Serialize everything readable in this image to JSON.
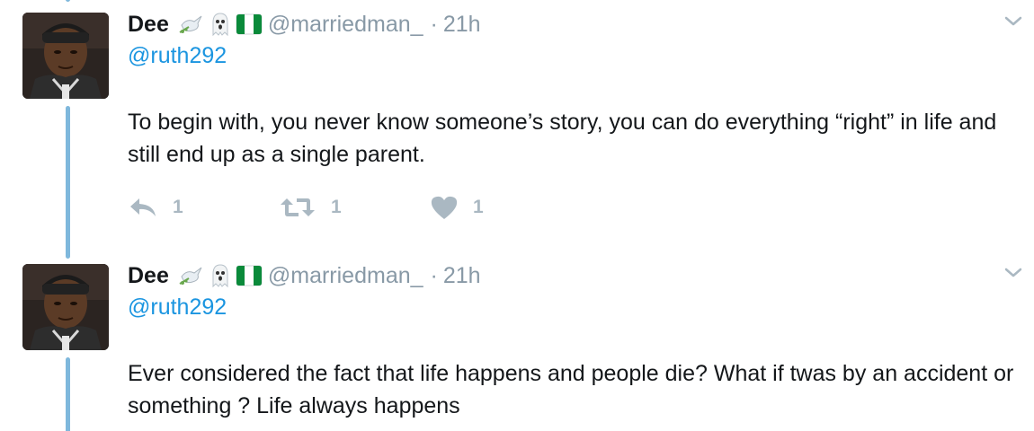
{
  "tweets": [
    {
      "author": {
        "name": "Dee",
        "handle": "@marriedman_",
        "emojis": [
          "dove-icon",
          "ghost-icon",
          "nigeria-flag-icon"
        ]
      },
      "separator": "·",
      "time": "21h",
      "reply_to": "@ruth292",
      "text": "To begin with, you never know someone’s story, you can do everything “right” in life and still end up as a single parent.",
      "actions": {
        "reply_count": "1",
        "retweet_count": "1",
        "like_count": "1"
      }
    },
    {
      "author": {
        "name": "Dee",
        "handle": "@marriedman_",
        "emojis": [
          "dove-icon",
          "ghost-icon",
          "nigeria-flag-icon"
        ]
      },
      "separator": "·",
      "time": "21h",
      "reply_to": "@ruth292",
      "text": "Ever considered the fact that life happens and people die? What if twas by an accident or something ? Life always happens"
    }
  ],
  "colors": {
    "thread_line": "#7fb8dc",
    "link": "#1b95e0",
    "muted": "#8899a6",
    "action_gray": "#aab8c2"
  },
  "icons": {
    "menu": "chevron-down-icon",
    "reply": "reply-icon",
    "retweet": "retweet-icon",
    "like": "heart-icon"
  }
}
